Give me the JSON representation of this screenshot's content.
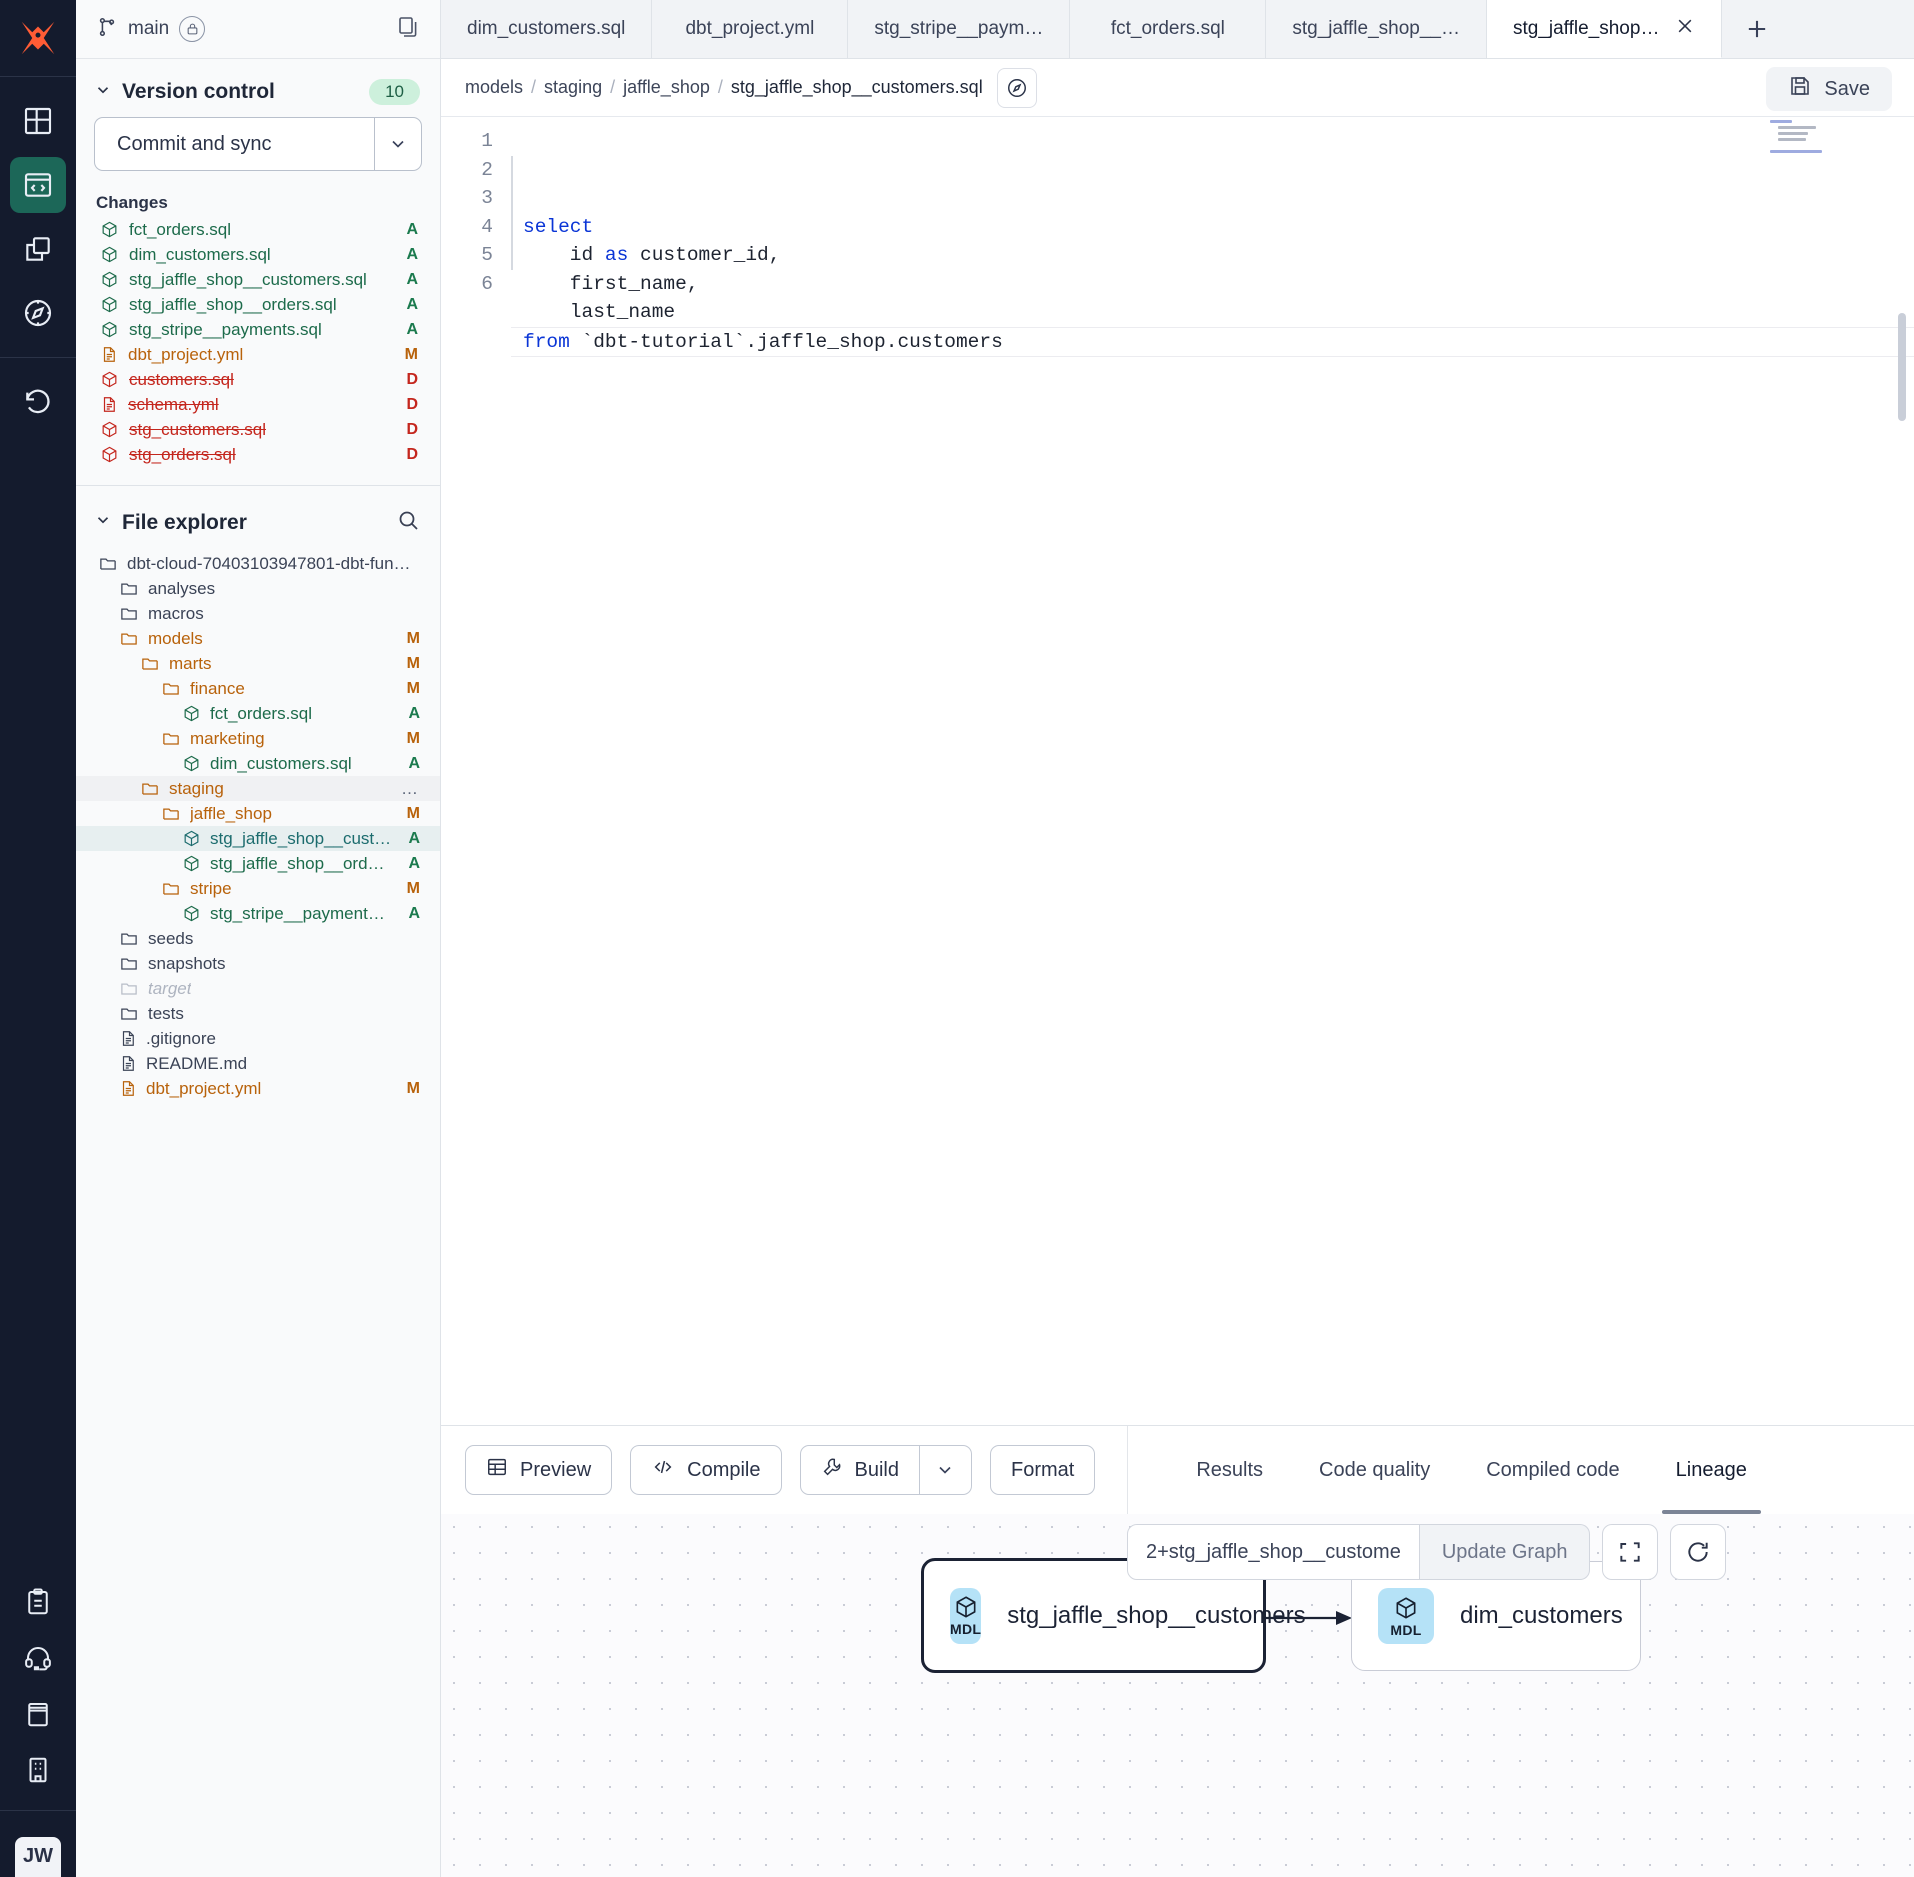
{
  "rail": {
    "logo": "dbt-logo-icon",
    "items": [
      {
        "name": "dashboard-icon",
        "label": "Explore"
      },
      {
        "name": "code-editor-icon",
        "label": "Develop",
        "active": true
      },
      {
        "name": "copy-windows-icon",
        "label": "Deploy"
      },
      {
        "name": "compass-icon",
        "label": "Discover"
      },
      {
        "name": "history-undo-icon",
        "label": "History"
      }
    ],
    "bottom_items": [
      {
        "name": "clipboard-icon",
        "label": "Notifications"
      },
      {
        "name": "headset-icon",
        "label": "Support"
      },
      {
        "name": "book-icon",
        "label": "Docs"
      },
      {
        "name": "building-icon",
        "label": "Account"
      }
    ],
    "avatar_initials": "JW"
  },
  "sidebar": {
    "branch": {
      "name": "main",
      "branch_icon": "git-branch-icon",
      "lock_icon": "lock-icon",
      "copy_icon": "copy-icon"
    },
    "version_control": {
      "title": "Version control",
      "chevron": "chevron-down-icon",
      "count": "10",
      "commit_label": "Commit and sync",
      "commit_caret": "chevron-down-icon",
      "changes_label": "Changes",
      "changes": [
        {
          "name": "fct_orders.sql",
          "status": "A",
          "kind": "model"
        },
        {
          "name": "dim_customers.sql",
          "status": "A",
          "kind": "model"
        },
        {
          "name": "stg_jaffle_shop__customers.sql",
          "status": "A",
          "kind": "model"
        },
        {
          "name": "stg_jaffle_shop__orders.sql",
          "status": "A",
          "kind": "model"
        },
        {
          "name": "stg_stripe__payments.sql",
          "status": "A",
          "kind": "model"
        },
        {
          "name": "dbt_project.yml",
          "status": "M",
          "kind": "file"
        },
        {
          "name": "customers.sql",
          "status": "D",
          "kind": "model"
        },
        {
          "name": "schema.yml",
          "status": "D",
          "kind": "file"
        },
        {
          "name": "stg_customers.sql",
          "status": "D",
          "kind": "model"
        },
        {
          "name": "stg_orders.sql",
          "status": "D",
          "kind": "model"
        }
      ]
    },
    "file_explorer": {
      "title": "File explorer",
      "chevron": "chevron-down-icon",
      "search_icon": "search-icon",
      "tree": [
        {
          "label": "dbt-cloud-70403103947801-dbt-funda…",
          "indent": 0,
          "kind": "root-folder",
          "badge": ""
        },
        {
          "label": "analyses",
          "indent": 1,
          "kind": "folder",
          "badge": ""
        },
        {
          "label": "macros",
          "indent": 1,
          "kind": "folder",
          "badge": ""
        },
        {
          "label": "models",
          "indent": 1,
          "kind": "folder-m",
          "badge": "M"
        },
        {
          "label": "marts",
          "indent": 2,
          "kind": "folder-m",
          "badge": "M"
        },
        {
          "label": "finance",
          "indent": 3,
          "kind": "folder-m",
          "badge": "M"
        },
        {
          "label": "fct_orders.sql",
          "indent": 4,
          "kind": "model",
          "badge": "A"
        },
        {
          "label": "marketing",
          "indent": 3,
          "kind": "folder-m",
          "badge": "M"
        },
        {
          "label": "dim_customers.sql",
          "indent": 4,
          "kind": "model",
          "badge": "A"
        },
        {
          "label": "staging",
          "indent": 2,
          "kind": "folder-m",
          "badge": "…",
          "hover": true
        },
        {
          "label": "jaffle_shop",
          "indent": 3,
          "kind": "folder-m",
          "badge": "M"
        },
        {
          "label": "stg_jaffle_shop__customers.sql",
          "indent": 4,
          "kind": "model-selected",
          "badge": "A",
          "selected": true
        },
        {
          "label": "stg_jaffle_shop__orders.sql",
          "indent": 4,
          "kind": "model",
          "badge": "A"
        },
        {
          "label": "stripe",
          "indent": 3,
          "kind": "folder-m",
          "badge": "M"
        },
        {
          "label": "stg_stripe__payments.sql",
          "indent": 4,
          "kind": "model",
          "badge": "A"
        },
        {
          "label": "seeds",
          "indent": 1,
          "kind": "folder",
          "badge": ""
        },
        {
          "label": "snapshots",
          "indent": 1,
          "kind": "folder",
          "badge": ""
        },
        {
          "label": "target",
          "indent": 1,
          "kind": "folder-dim",
          "badge": ""
        },
        {
          "label": "tests",
          "indent": 1,
          "kind": "folder",
          "badge": ""
        },
        {
          "label": ".gitignore",
          "indent": 1,
          "kind": "file",
          "badge": ""
        },
        {
          "label": "README.md",
          "indent": 1,
          "kind": "file",
          "badge": ""
        },
        {
          "label": "dbt_project.yml",
          "indent": 1,
          "kind": "file-m",
          "badge": "M"
        }
      ]
    }
  },
  "tabs": [
    {
      "label": "dim_customers.sql",
      "active": false
    },
    {
      "label": "dbt_project.yml",
      "active": false
    },
    {
      "label": "stg_stripe__paym…",
      "active": false
    },
    {
      "label": "fct_orders.sql",
      "active": false
    },
    {
      "label": "stg_jaffle_shop__…",
      "active": false
    },
    {
      "label": "stg_jaffle_shop…",
      "active": true,
      "close_icon": "close-icon"
    }
  ],
  "new_tab_icon": "plus-icon",
  "breadcrumb": {
    "parts": [
      "models",
      "staging",
      "jaffle_shop",
      "stg_jaffle_shop__customers.sql"
    ],
    "compass_icon": "compass-icon"
  },
  "save": {
    "label": "Save",
    "icon": "save-disk-icon"
  },
  "editor": {
    "lines": [
      {
        "num": "1",
        "tokens": [
          {
            "t": "select",
            "c": "kw"
          }
        ]
      },
      {
        "num": "2",
        "tokens": [
          {
            "t": "    id ",
            "c": ""
          },
          {
            "t": "as",
            "c": "kw"
          },
          {
            "t": " customer_id,",
            "c": ""
          }
        ]
      },
      {
        "num": "3",
        "tokens": [
          {
            "t": "    first_name,",
            "c": ""
          }
        ]
      },
      {
        "num": "4",
        "tokens": [
          {
            "t": "    last_name",
            "c": ""
          }
        ]
      },
      {
        "num": "5",
        "tokens": [
          {
            "t": "",
            "c": ""
          }
        ]
      },
      {
        "num": "6",
        "tokens": [
          {
            "t": "from",
            "c": "kw"
          },
          {
            "t": " `dbt-tutorial`.jaffle_shop.customers",
            "c": ""
          }
        ]
      }
    ]
  },
  "bottom_toolbar": {
    "preview": {
      "label": "Preview",
      "icon": "table-grid-icon"
    },
    "compile": {
      "label": "Compile",
      "icon": "code-brackets-icon"
    },
    "build": {
      "label": "Build",
      "icon": "wrench-icon",
      "caret": "chevron-down-icon"
    },
    "format": {
      "label": "Format"
    }
  },
  "result_tabs": [
    {
      "label": "Results",
      "active": false
    },
    {
      "label": "Code quality",
      "active": false
    },
    {
      "label": "Compiled code",
      "active": false
    },
    {
      "label": "Lineage",
      "active": true
    }
  ],
  "lineage": {
    "nodes": [
      {
        "id": "stg",
        "label": "stg_jaffle_shop__customers",
        "badge": "MDL",
        "badge_icon": "cube-icon",
        "primary": true
      },
      {
        "id": "dim",
        "label": "dim_customers",
        "badge": "MDL",
        "badge_icon": "cube-icon",
        "primary": false
      }
    ],
    "edges": [
      {
        "from": "stg",
        "to": "dim"
      }
    ],
    "controls": {
      "selector_value": "2+stg_jaffle_shop__custome",
      "update_label": "Update Graph",
      "fullscreen_icon": "expand-fullscreen-icon",
      "refresh_icon": "refresh-icon"
    }
  },
  "colors": {
    "brand_orange": "#ff5c35",
    "rail_bg": "#141b2d",
    "active_green": "#1c6758",
    "added_green": "#1b7a4e",
    "modified_orange": "#b8620b",
    "deleted_red": "#c4261d",
    "badge_green_bg": "#cdf0dc",
    "node_badge_blue": "#b5e2f7",
    "keyword_blue": "#0a35d6"
  }
}
